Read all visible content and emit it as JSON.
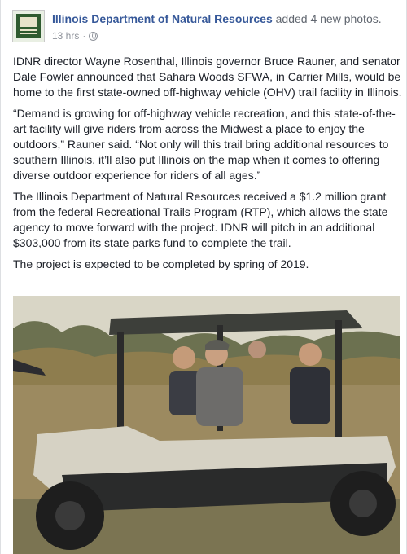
{
  "post": {
    "page_name": "Illinois Department of Natural Resources",
    "action_text": " added 4 new photos.",
    "timestamp": "13 hrs",
    "separator": "·",
    "privacy_icon": "globe-icon",
    "avatar_icon": "idnr-logo",
    "paragraphs": [
      "IDNR director Wayne Rosenthal, Illinois governor Bruce Rauner, and senator Dale Fowler announced that Sahara Woods SFWA, in Carrier Mills, would be home to the first state-owned off-highway vehicle (OHV) trail facility in Illinois.",
      "“Demand is growing for off-highway vehicle recreation, and this state-of-the-art facility will give riders from across the Midwest a place to enjoy the outdoors,” Rauner said. “Not only will this trail bring additional resources to southern Illinois, it’ll also put Illinois on the map when it comes to offering diverse outdoor experience for riders of all ages.”",
      "The Illinois Department of Natural Resources received a $1.2 million grant from the federal Recreational Trails Program (RTP), which allows the state agency to move forward with the project. IDNR will pitch in an additional $303,000 from its state parks fund to complete the trail.",
      "The project is expected to be completed by spring of 2019."
    ]
  },
  "colors": {
    "link": "#365899",
    "meta": "#90949c",
    "text": "#1d2129"
  }
}
